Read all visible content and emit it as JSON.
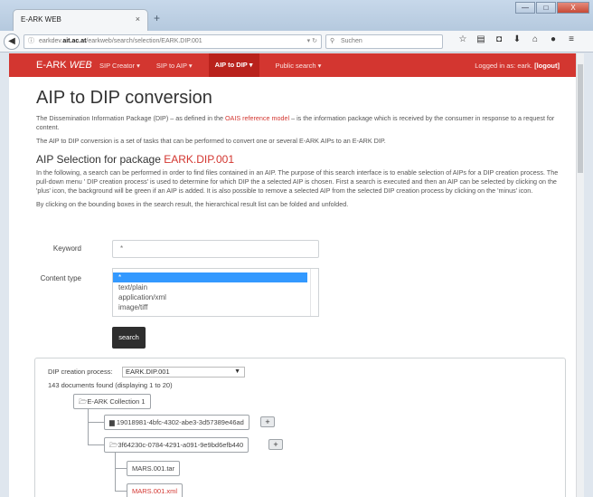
{
  "browser": {
    "tab_title": "E-ARK WEB",
    "tab_close": "×",
    "new_tab": "+",
    "window_controls": [
      "—",
      "□",
      "X"
    ],
    "url_prefix": "earkdev.",
    "url_domain": "ait.ac.at",
    "url_path": "/earkweb/search/selection/EARK.DIP.001",
    "search_placeholder": "Suchen"
  },
  "nav": {
    "brand_plain": "E-ARK ",
    "brand_italic": "WEB",
    "items": [
      "SIP Creator ▾",
      "SIP to AIP ▾",
      "AIP to DIP ▾",
      "Public search ▾"
    ],
    "active_index": 2,
    "login_text": "Logged in as: eark. ",
    "logout_text": "[logout]"
  },
  "page": {
    "title": "AIP to DIP conversion",
    "intro_1a": "The Dissemination Information Package (DIP) – as defined in the ",
    "intro_1_link": "OAIS reference model",
    "intro_1b": " – is the information package which is received by the consumer in response to a request for content.",
    "intro_2": "The AIP to DIP conversion is a set of tasks that can be performed to convert one or several E-ARK AIPs to an E-ARK DIP.",
    "selection_heading": "AIP Selection for package ",
    "selection_package": "EARK.DIP.001",
    "selection_text": "In the following, a search can be performed in order to find files contained in an AIP. The purpose of this search interface is to enable selection of AIPs for a DIP creation process. The pull-down menu ' DIP creation process' is used to determine for which DIP the a selected AIP is chosen. First a search is executed and then an AIP can be selected by clicking on the 'plus' icon, the background will be green if an AIP is added. It is also possible to remove a selected AIP from the selected DIP creation process by clicking on the 'minus' icon.",
    "fold_text": "By clicking on the bounding boxes in the search result, the hierarchical result list can be folded and unfolded."
  },
  "form": {
    "keyword_label": "Keyword",
    "keyword_value": "*",
    "content_type_label": "Content type",
    "content_types": [
      "*",
      "text/plain",
      "application/xml",
      "image/tiff"
    ],
    "content_type_selected": 0,
    "search_button": "search"
  },
  "results": {
    "dip_label": "DIP creation process:",
    "dip_value": "EARK.DIP.001",
    "count_text": "143 documents found (displaying 1 to 20)",
    "tree": {
      "collection": "E-ARK Collection 1",
      "aip1": "19018981-4bfc-4302-abe3-3d57389e46ad",
      "aip2": "3f64230c-0784-4291-a091-9e9bd6efb440",
      "file1": "MARS.001.tar",
      "file2": "MARS.001.xml"
    },
    "plus_symbol": "+"
  }
}
